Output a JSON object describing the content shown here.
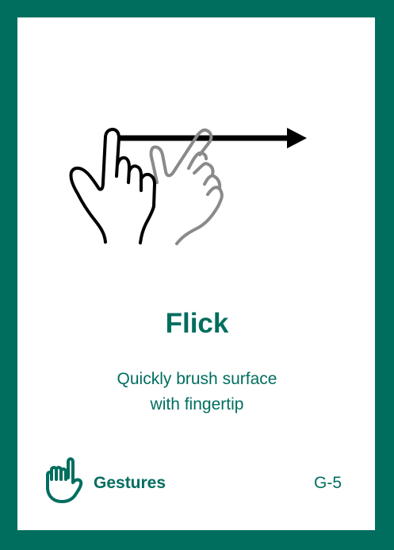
{
  "card": {
    "title": "Flick",
    "description_line1": "Quickly brush surface",
    "description_line2": "with fingertip",
    "category": "Gestures",
    "code": "G-5"
  },
  "colors": {
    "brand": "#006e5f",
    "ink": "#000000",
    "ghost_hand": "#8a8a8a"
  },
  "icons": {
    "illustration": "flick-hand-arrow-icon",
    "category": "pointing-hand-icon"
  }
}
